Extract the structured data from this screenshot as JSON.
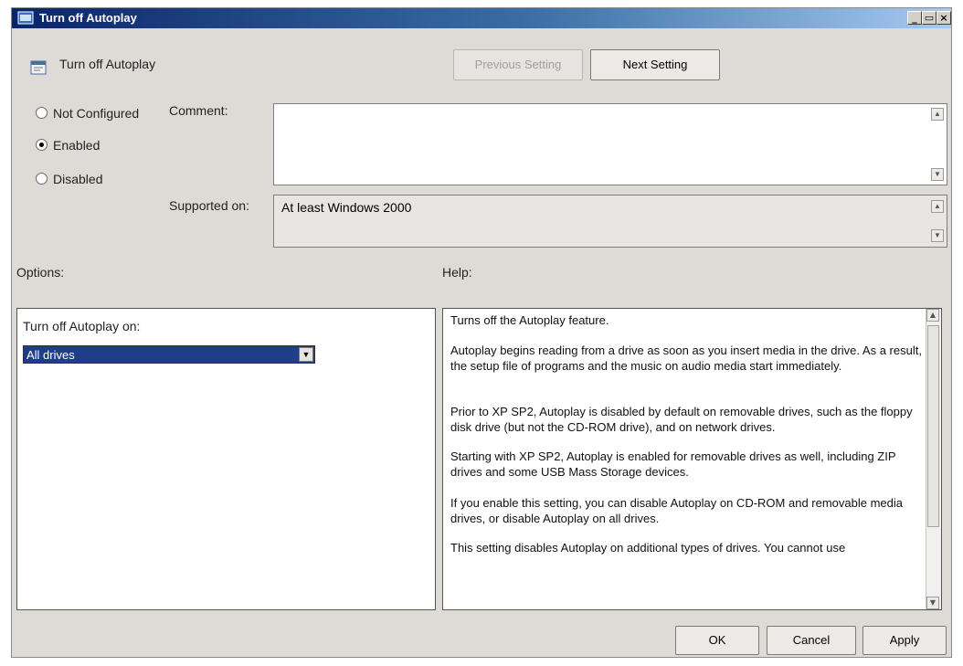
{
  "window": {
    "title": "Turn off Autoplay",
    "caption_buttons": {
      "minimize": "_",
      "maximize": "▭",
      "close": "×"
    }
  },
  "header": {
    "policy_title": "Turn off Autoplay",
    "previous_setting": "Previous Setting",
    "next_setting": "Next Setting"
  },
  "state": {
    "options": [
      {
        "label": "Not Configured",
        "checked": false
      },
      {
        "label": "Enabled",
        "checked": true
      },
      {
        "label": "Disabled",
        "checked": false
      }
    ]
  },
  "comment": {
    "label": "Comment:",
    "value": ""
  },
  "supported": {
    "label": "Supported on:",
    "value": "At least Windows 2000"
  },
  "options_section": {
    "heading": "Options:",
    "field_label": "Turn off Autoplay on:",
    "selected_value": "All drives"
  },
  "help_section": {
    "heading": "Help:",
    "paragraphs": [
      "Turns off the Autoplay feature.",
      "Autoplay begins reading from a drive as soon as you insert media in the drive. As a result, the setup file of programs and the music on audio media start immediately.",
      "Prior to XP SP2, Autoplay is disabled by default on removable drives, such as the floppy disk drive (but not the CD-ROM drive), and on network drives.",
      "Starting with XP SP2, Autoplay is enabled for removable drives as well, including ZIP drives and some USB Mass Storage devices.",
      "If you enable this setting, you can disable Autoplay on CD-ROM and removable media drives, or disable Autoplay on all drives.",
      "This setting disables Autoplay on additional types of drives. You cannot use"
    ]
  },
  "footer": {
    "ok": "OK",
    "cancel": "Cancel",
    "apply": "Apply"
  },
  "icons": {
    "scroll_up": "▲",
    "scroll_down": "▼",
    "dropdown": "▼"
  },
  "colors": {
    "title_bar_start": "#0a246a",
    "selection": "#1f3e8a",
    "dialog_bg": "#dedbd6"
  }
}
